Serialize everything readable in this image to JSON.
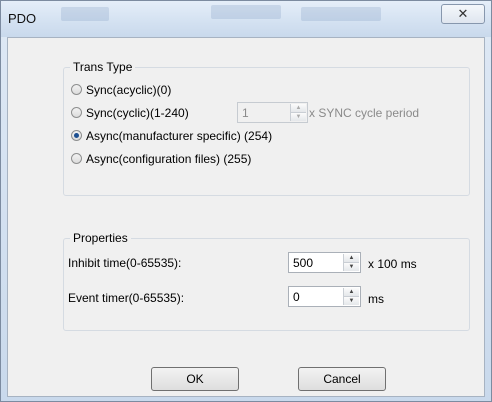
{
  "window": {
    "title": "PDO",
    "close_glyph": "✕"
  },
  "trans_type": {
    "title": "Trans Type",
    "options": [
      {
        "label": "Sync(acyclic)(0)",
        "checked": false
      },
      {
        "label": "Sync(cyclic)(1-240)",
        "checked": false
      },
      {
        "label": "Async(manufacturer specific) (254)",
        "checked": true
      },
      {
        "label": "Async(configuration files) (255)",
        "checked": false
      }
    ],
    "cycle_value": "1",
    "cycle_suffix": "x SYNC cycle period"
  },
  "properties": {
    "title": "Properties",
    "inhibit_label": "Inhibit time(0-65535):",
    "inhibit_value": "500",
    "inhibit_unit": "x 100 ms",
    "event_label": "Event timer(0-65535):",
    "event_value": "0",
    "event_unit": "ms"
  },
  "buttons": {
    "ok": "OK",
    "cancel": "Cancel"
  },
  "icons": {
    "spin_up": "▲",
    "spin_down": "▼",
    "close": "close-icon"
  }
}
